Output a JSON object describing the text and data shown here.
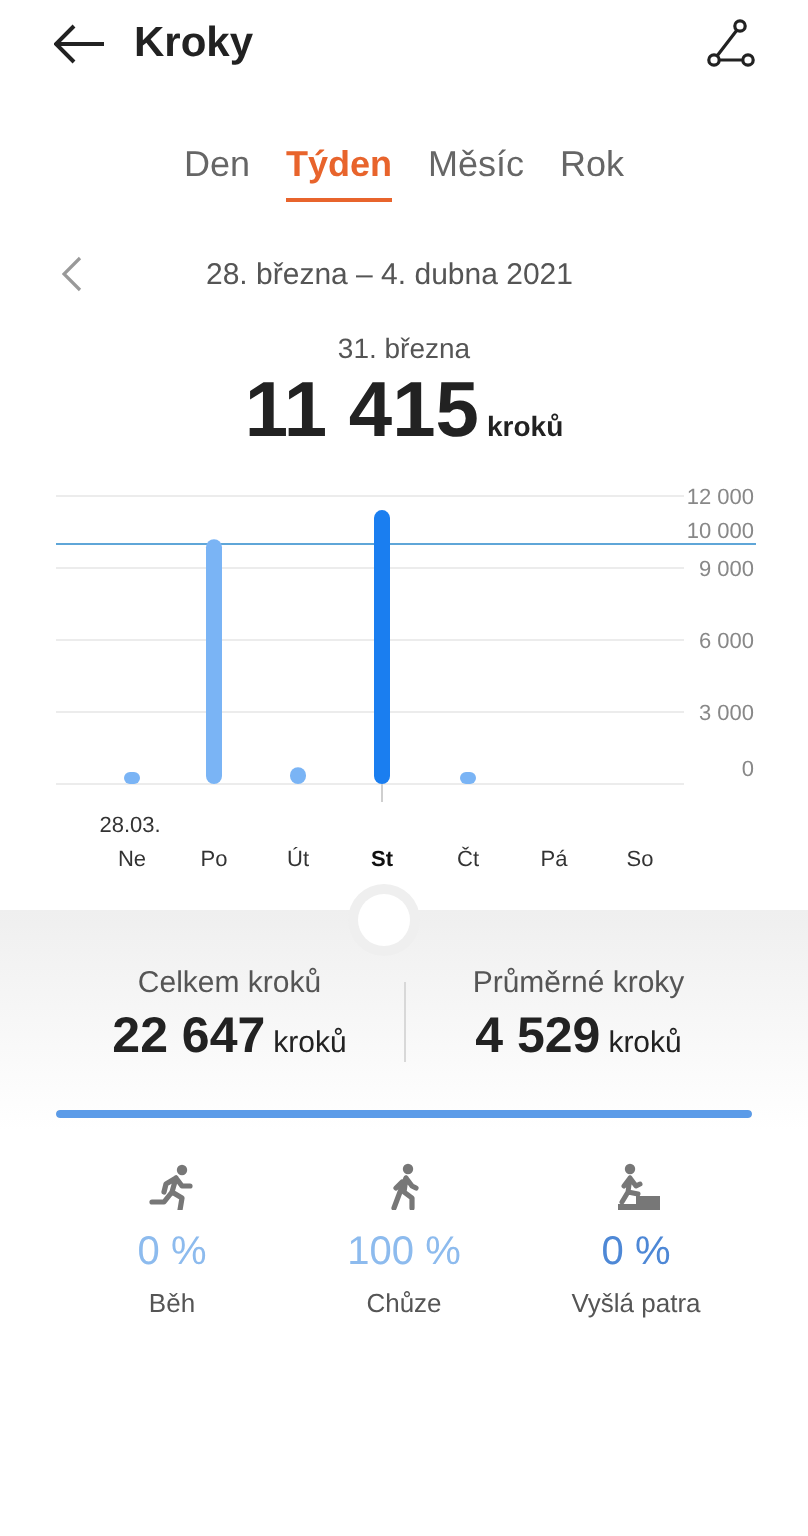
{
  "header": {
    "title": "Kroky"
  },
  "tabs": [
    {
      "label": "Den",
      "selected": false
    },
    {
      "label": "Týden",
      "selected": true
    },
    {
      "label": "Měsíc",
      "selected": false
    },
    {
      "label": "Rok",
      "selected": false
    }
  ],
  "period": {
    "range": "28. března – 4. dubna 2021"
  },
  "selected_day": {
    "date": "31. března",
    "value": "11 415",
    "unit": "kroků"
  },
  "chart": {
    "chart_data": {
      "type": "bar",
      "categories": [
        "Ne",
        "Po",
        "Út",
        "St",
        "Čt",
        "Pá",
        "So"
      ],
      "grid": true,
      "series": [
        {
          "color": "#7ab4f5",
          "values": [
            500,
            10200,
            700,
            null,
            500,
            null,
            null
          ]
        },
        {
          "color": "#1a7ef0",
          "values": [
            null,
            null,
            null,
            11415,
            null,
            null,
            null
          ]
        }
      ],
      "ylim": [
        0,
        12000
      ],
      "yticks": [
        {
          "value": 0,
          "label": "0"
        },
        {
          "value": 3000,
          "label": "3 000"
        },
        {
          "value": 6000,
          "label": "6 000"
        },
        {
          "value": 9000,
          "label": "9 000"
        },
        {
          "value": 12000,
          "label": "12 000"
        }
      ],
      "ref_lines": [
        {
          "axis": "y",
          "value": 10000,
          "label": "10 000",
          "color": "#5fa6d8"
        }
      ]
    },
    "days": [
      {
        "date": "28.03.",
        "selected": false
      },
      {
        "selected": false
      },
      {
        "selected": false
      },
      {
        "selected": true
      },
      {
        "selected": false
      },
      {
        "selected": false
      },
      {
        "selected": false
      }
    ]
  },
  "summary": [
    {
      "label": "Celkem kroků",
      "value": "22 647",
      "unit": "kroků"
    },
    {
      "label": "Průměrné kroky",
      "value": "4 529",
      "unit": "kroků"
    }
  ],
  "progress": {
    "level": 1
  },
  "activities": [
    {
      "kind": "run",
      "percent": "0 %",
      "label": "Běh",
      "color": "#8dbbee"
    },
    {
      "kind": "walk",
      "percent": "100 %",
      "label": "Chůze",
      "color": "#8dbbee"
    },
    {
      "kind": "climb",
      "percent": "0 %",
      "label": "Vyšlá patra",
      "color": "#4e88d6"
    }
  ]
}
